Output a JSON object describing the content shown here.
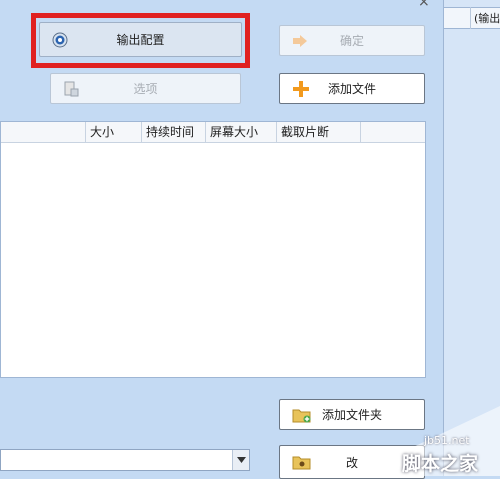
{
  "window": {
    "close_glyph": "×"
  },
  "buttons": {
    "output_config": "输出配置",
    "confirm": "确定",
    "options": "选项",
    "add_file": "添加文件",
    "add_folder": "添加文件夹",
    "change_partial": "改"
  },
  "table": {
    "columns": [
      "大小",
      "持续时间",
      "屏幕大小",
      "截取片断"
    ]
  },
  "right_strip": {
    "header": "(输出"
  },
  "watermark": {
    "url": "jb51.net",
    "text": "脚本之家"
  },
  "colors": {
    "highlight": "#e02020",
    "plus": "#f29a1e"
  }
}
